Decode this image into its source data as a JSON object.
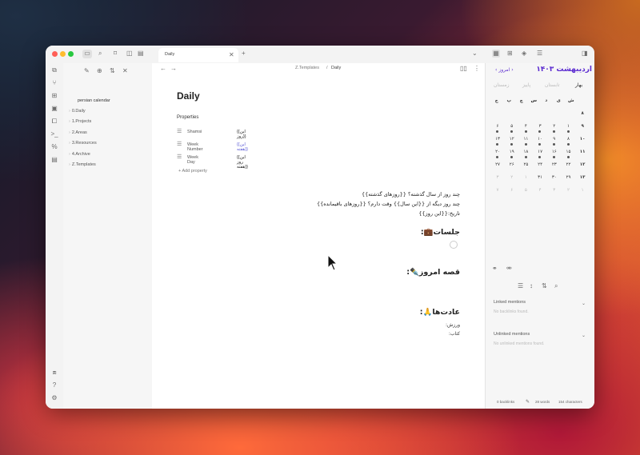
{
  "tab": {
    "label": "Daily"
  },
  "breadcrumb": {
    "folder": "Z.Templates",
    "sep": "/",
    "file": "Daily"
  },
  "vault": {
    "name": "persian calendar"
  },
  "folders": [
    "0.Daily",
    "1.Projects",
    "2.Areas",
    "3.Resources",
    "4.Archive",
    "Z.Templates"
  ],
  "document": {
    "title": "Daily",
    "properties_label": "Properties",
    "properties": [
      {
        "key": "Shamsi",
        "value": "{{این روز}}",
        "color": "#222222"
      },
      {
        "key": "Week Number",
        "value": "{{این هفته}}",
        "color": "#5b5bd6"
      },
      {
        "key": "Week Day",
        "value": "{{این روز هفته}}",
        "color": "#222222"
      }
    ],
    "add_property": "Add property",
    "body_lines": [
      "چند روز از سال گذشته؟ {{روزهای گذشته}}",
      "چند روز دیگه از {{این سال}} وقت دارم؟ {{روزهای باقیمانده}}",
      "تاریخ:{{این روز}}"
    ],
    "heading_meetings": "جلسات💼:",
    "heading_story": "قصه امروز✒️:",
    "heading_habits": "عادت‌ها🙏:",
    "habits": [
      "ورزش:",
      "کتاب:"
    ]
  },
  "calendar": {
    "month_year": "اردیبهشت ۱۴۰۳",
    "today": "امروز",
    "prev": "‹",
    "next": "›",
    "season": "بهار",
    "season_dim_1": "تابستان",
    "season_dim_2": "پاییز",
    "season_dim_3": "زمستان",
    "weekdays": [
      "ش",
      "ی",
      "د",
      "س",
      "چ",
      "پ",
      "ج"
    ],
    "rows": [
      [
        "۸",
        "",
        "",
        "",
        "",
        "",
        ""
      ],
      [
        "۹",
        "۱",
        "۲",
        "۳",
        "۴",
        "۵",
        "۶"
      ],
      [
        "۱۰",
        "۸",
        "۹",
        "۱۰",
        "۱۱",
        "۱۲",
        "۱۳"
      ],
      [
        "۱۱",
        "۱۵",
        "۱۶",
        "۱۷",
        "۱۸",
        "۱۹",
        "۲۰"
      ],
      [
        "۱۲",
        "۲۲",
        "۲۳",
        "۲۴",
        "۲۵",
        "۲۶",
        "۲۷"
      ],
      [
        "۱۳",
        "۲۹",
        "۳۰",
        "۳۱",
        "۱",
        "۲",
        "۳"
      ]
    ],
    "dim_row_text": [
      "۱",
      "۲",
      "۳",
      "۴",
      "۵",
      "۶",
      "۷"
    ]
  },
  "backlinks": {
    "linked_title": "Linked mentions",
    "linked_empty": "No backlinks found.",
    "unlinked_title": "Unlinked mentions",
    "unlinked_empty": "No unlinked mentions found."
  },
  "statusbar": {
    "backlinks": "0 backlinks",
    "words": "28 words",
    "chars": "154 characters"
  },
  "colors": {
    "accent": "#5b2bd0",
    "window_bg": "#ffffff",
    "sidebar_bg": "#f6f6f6"
  }
}
